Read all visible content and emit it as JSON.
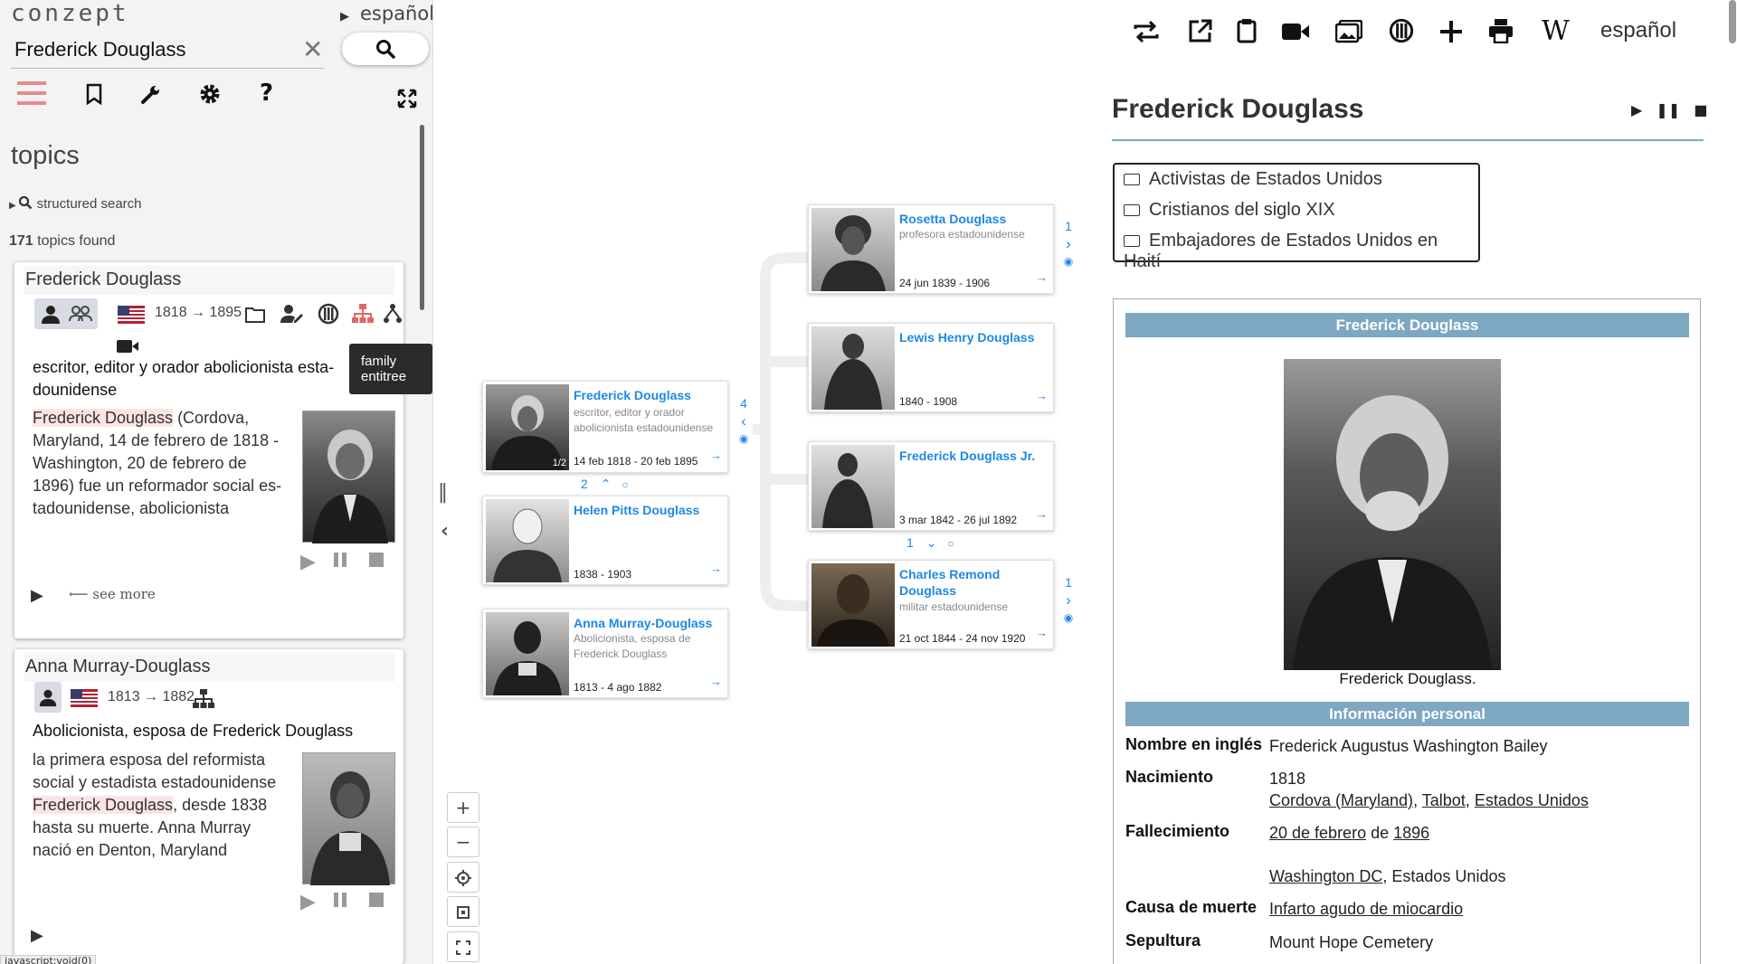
{
  "app": {
    "logo": "conzept",
    "language": "español"
  },
  "search": {
    "value": "Frederick Douglass",
    "placeholder": ""
  },
  "topics": {
    "heading": "topics",
    "structured_search": "structured search",
    "count": "171",
    "found_label": "topics found"
  },
  "tooltip": "family entitree",
  "status_link": "javascript:void(0)",
  "cards": [
    {
      "title": "Frederick Douglass",
      "years": "1818 → 1895",
      "desc_a": "escritor, editor y orador abolicionista esta-",
      "desc_b": "dounidense",
      "text_hl": "Frederick Douglass",
      "text_1": " (Cordova,",
      "text_2": "Maryland, 14 de febrero de 1818 -",
      "text_3": "Washington, 20 de febrero de",
      "text_4": "1896) fue un reformador social es-",
      "text_5": "tadounidense, abolicionista",
      "see_more": "see more"
    },
    {
      "title": "Anna Murray-Douglass",
      "years": "1813 → 1882",
      "desc": "Abolicionista, esposa de Frederick Douglass",
      "text_1": "la primera esposa del reformista",
      "text_2": "social y estadista estadounidense",
      "text_hl": "Frederick Douglass",
      "text_3": ", desde 1838",
      "text_4": "hasta su muerte. Anna Murray",
      "text_5": "nació en Denton, Maryland"
    }
  ],
  "tree": {
    "root": {
      "name": "Frederick Douglass",
      "desc": "escritor, editor y orador abolicionista estadounidense",
      "dates": "14 feb 1818 - 20 feb 1895",
      "badge": "1/2",
      "side_count": "4",
      "below_count": "2"
    },
    "spouses": [
      {
        "name": "Helen Pitts Douglass",
        "desc": "",
        "dates": "1838 - 1903"
      },
      {
        "name": "Anna Murray-Douglass",
        "desc": "Abolicionista, esposa de Frederick Douglass",
        "dates": "1813 - 4 ago 1882"
      }
    ],
    "children": [
      {
        "name": "Rosetta Douglass",
        "desc": "profesora estadounidense",
        "dates": "24 jun 1839 - 1906",
        "side_count": "1"
      },
      {
        "name": "Lewis Henry Douglass",
        "desc": "",
        "dates": "1840 - 1908"
      },
      {
        "name": "Frederick Douglass Jr.",
        "desc": "",
        "dates": "3 mar 1842 - 26 jul 1892",
        "below_count": "1"
      },
      {
        "name": "Charles Remond Douglass",
        "desc": "militar estadounidense",
        "dates": "21 oct 1844 - 24 nov 1920",
        "side_count": "1"
      }
    ],
    "arrow": "→"
  },
  "right": {
    "language": "español",
    "title": "Frederick Douglass",
    "categories": [
      "Activistas de Estados Unidos",
      "Cristianos del siglo XIX",
      "Embajadores de Estados Unidos en Haití"
    ],
    "infobox": {
      "header": "Frederick Douglass",
      "caption": "Frederick Douglass.",
      "section": "Información personal",
      "rows": [
        {
          "k": "Nombre en inglés",
          "v": "Frederick Augustus Washington Bailey"
        },
        {
          "k": "Nacimiento",
          "v1": "1818",
          "v2a": "Cordova (Maryland)",
          "v2b": "Talbot",
          "v2c": "Estados Unidos"
        },
        {
          "k": "Fallecimiento",
          "v1a": "20 de febrero",
          "v1mid": " de ",
          "v1b": "1896",
          "v2a": "Washington DC",
          "v2b": ", Estados Unidos"
        },
        {
          "k": "Causa de muerte",
          "v": "Infarto agudo de miocardio"
        },
        {
          "k": "Sepultura",
          "v": "Mount Hope Cemetery"
        }
      ]
    }
  },
  "colors": {
    "accent": "#1e88e5",
    "infobox_header": "#7ea7c2",
    "highlight": "#fde4e4",
    "menu": "#e88a8a"
  }
}
